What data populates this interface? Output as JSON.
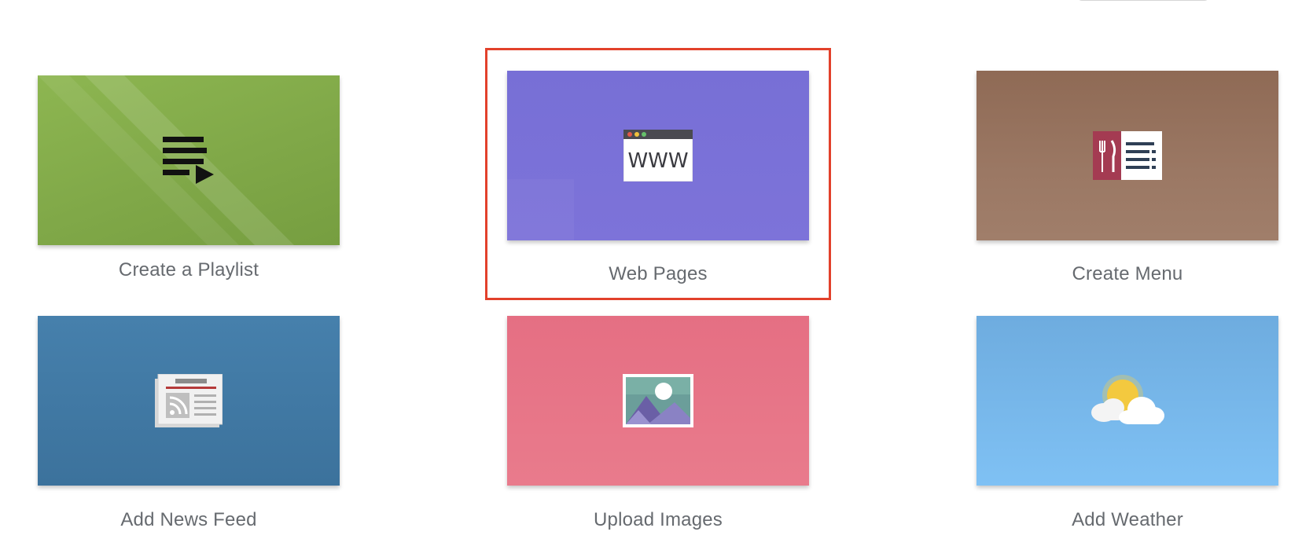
{
  "tiles": [
    {
      "label": "Create a Playlist",
      "icon": "playlist-icon",
      "color": "#87ad4e"
    },
    {
      "label": "Web Pages",
      "icon": "web-page-icon",
      "color": "#7970d6",
      "selected": true,
      "icon_text": "WWW"
    },
    {
      "label": "Create Menu",
      "icon": "restaurant-menu-icon",
      "color": "#97705d"
    },
    {
      "label": "Add News Feed",
      "icon": "news-feed-icon",
      "color": "#3f78a4"
    },
    {
      "label": "Upload Images",
      "icon": "image-icon",
      "color": "#e87789"
    },
    {
      "label": "Add Weather",
      "icon": "weather-icon",
      "color": "#79b8ec"
    }
  ],
  "colors": {
    "selection": "#e2412b",
    "label_text": "#666a6f"
  }
}
